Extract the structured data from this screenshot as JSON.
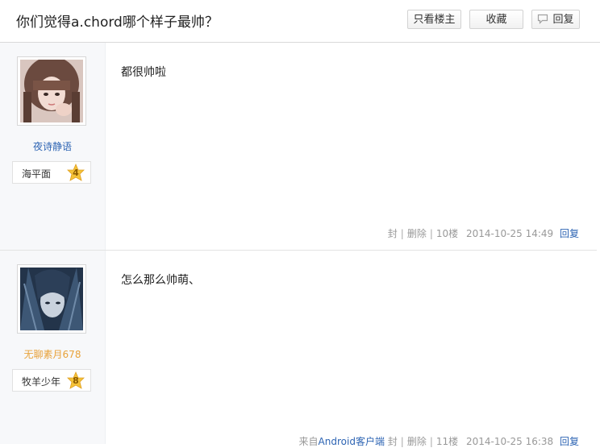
{
  "thread": {
    "title": "你们觉得a.chord哪个样子最帅？"
  },
  "header": {
    "only_op_label": "只看楼主",
    "favorite_label": "收藏",
    "reply_label": "回复"
  },
  "posts": [
    {
      "username": "夜诗静语",
      "level_name": "海平面",
      "level": "4",
      "content": "都很帅啦",
      "ban_label": "封",
      "delete_label": "删除",
      "floor": "10楼",
      "time": "2014-10-25 14:49",
      "reply_label": "回复"
    },
    {
      "username": "无聊素月678",
      "level_name": "牧羊少年",
      "level": "8",
      "content": "怎么那么帅萌、",
      "client_prefix": "来自",
      "client": "Android客户端",
      "ban_label": "封",
      "delete_label": "删除",
      "floor": "11楼",
      "time": "2014-10-25 16:38",
      "reply_label": "回复"
    }
  ],
  "colors": {
    "link": "#2d64b3",
    "username_highlight": "#e8a23a",
    "badge": "#f5c338"
  }
}
